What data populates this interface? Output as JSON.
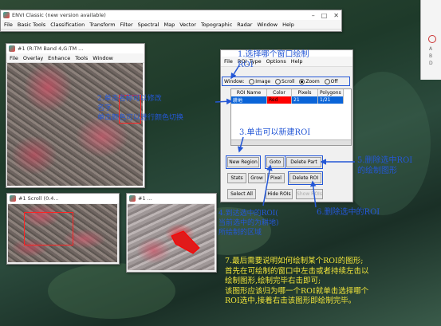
{
  "envi_main": {
    "title": "ENVI Classic (new version available)",
    "menu": [
      "File",
      "Basic Tools",
      "Classification",
      "Transform",
      "Filter",
      "Spectral",
      "Map",
      "Vector",
      "Topographic",
      "Radar",
      "Window",
      "Help"
    ]
  },
  "image_window": {
    "title": "#1 (R:TM Band 4,G:TM ...",
    "menu": [
      "File",
      "Overlay",
      "Enhance",
      "Tools",
      "Window"
    ]
  },
  "scroll_window": {
    "title": "#1 Scroll (0.4..."
  },
  "zoom_window": {
    "title": "#1 ..."
  },
  "roi_tool": {
    "menu": [
      "File",
      "ROI_Type",
      "Options",
      "Help"
    ],
    "window_label": "Window:",
    "radios": [
      "Image",
      "Scroll",
      "Zoom",
      "Off"
    ],
    "selected_radio": "Zoom",
    "columns": [
      "ROI Name",
      "Color",
      "Pixels",
      "Polygons"
    ],
    "rows": [
      {
        "name": "耕地",
        "color": "Red",
        "pixels": "21",
        "polygons": "1/21"
      }
    ],
    "buttons": {
      "new_region": "New Region",
      "goto": "Goto",
      "delete_part": "Delete Part",
      "stats": "Stats",
      "grow": "Grow",
      "pixel": "Pixel",
      "delete_roi": "Delete ROI",
      "select_all": "Select All",
      "hide_rois": "Hide ROIs",
      "show_rois": "Show ROIs"
    }
  },
  "side_panel_text": [
    "A",
    "B",
    "D"
  ],
  "annotations": {
    "a1_line1": "1.选择哪个窗口绘制",
    "a1_line2": "ROI",
    "a2_line1": "2.单击名称可以修改",
    "a2_line2": "名字",
    "a2_line3": "单击颜色可以进行颜色切换",
    "a3": "3.单击可以新建ROI",
    "a4_line1": "4.到达选中的ROI(",
    "a4_line2": "当前选中的为耕地)",
    "a4_line3": "所绘制的区域",
    "a5_line1": "5.删除选中ROI",
    "a5_line2": "的绘制图形",
    "a6": "6.删除选中的ROI",
    "a7_line1": "7.最后需要说明如何绘制某个ROI的图形;",
    "a7_line2": "首先在可绘制的窗口中左击或者持续左击以",
    "a7_line3": "绘制图形,绘制完毕右击即可;",
    "a7_line4": "该图形应该归为哪一个ROI就单击选择哪个",
    "a7_line5": "ROI选中,接着右击该图形即绘制完毕。"
  },
  "colors": {
    "annotation_blue": "#2457d6",
    "annotation_yellow": "#f0e43a",
    "roi_red": "#ff0000",
    "selection": "#0a64d8"
  }
}
